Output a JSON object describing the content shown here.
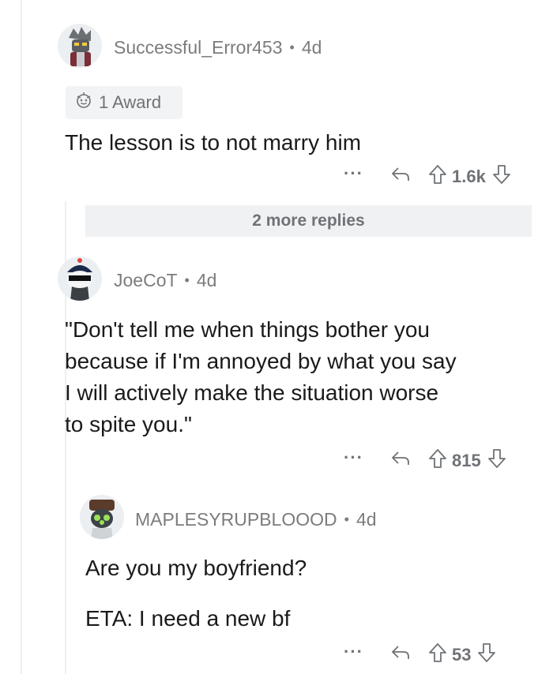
{
  "comments": [
    {
      "username": "Successful_Error453",
      "age": "4d",
      "award": "1 Award",
      "body": [
        "The lesson is to not marry him"
      ],
      "score": "1.6k"
    },
    {
      "more_replies": "2 more replies"
    },
    {
      "username": "JoeCoT",
      "age": "4d",
      "body": [
        "\"Don't tell me when things bother you",
        "because if I'm annoyed by what you say",
        "I will actively make the situation worse",
        "to spite you.\""
      ],
      "score": "815"
    },
    {
      "username": "MAPLESYRUPBLOOOD",
      "age": "4d",
      "body": [
        "Are you my boyfriend?",
        "ETA: I need a new bf"
      ],
      "score": "53"
    }
  ],
  "icons": {
    "more": "···",
    "reply": "reply-arrow-icon",
    "upvote": "upvote-arrow-icon",
    "downvote": "downvote-arrow-icon",
    "award": "award-icon"
  },
  "colors": {
    "text": "#1a1a1b",
    "meta": "#7c7c7c",
    "action": "#6f7276",
    "thread_line": "#edeff1",
    "panel": "#f0f1f2"
  }
}
